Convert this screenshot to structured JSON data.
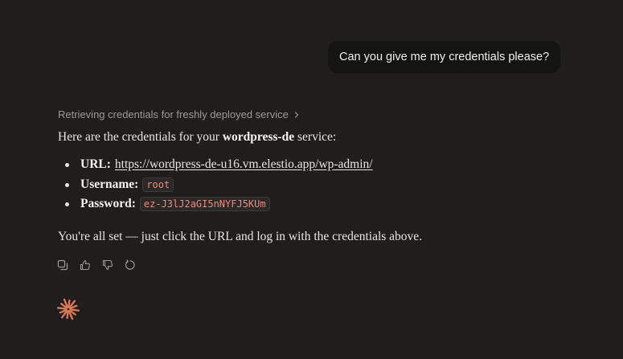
{
  "user_message": "Can you give me my credentials please?",
  "response": {
    "retrieving_label": "Retrieving credentials for freshly deployed service",
    "intro_before": "Here are the credentials for your ",
    "service_name": "wordpress-de",
    "intro_after": " service:",
    "credentials": {
      "url_label": "URL:",
      "url_value": "https://wordpress-de-u16.vm.elestio.app/wp-admin/",
      "username_label": "Username:",
      "username_value": "root",
      "password_label": "Password:",
      "password_value": "ez-J3lJ2aGI5nNYFJ5KUm"
    },
    "outro": "You're all set — just click the URL and log in with the credentials above."
  },
  "actions": [
    "copy-icon",
    "thumbs-up-icon",
    "thumbs-down-icon",
    "retry-icon"
  ],
  "colors": {
    "background": "#1f1e1d",
    "user_bubble": "#141413",
    "code_text": "#f08a7a",
    "brand_accent": "#d97757"
  }
}
